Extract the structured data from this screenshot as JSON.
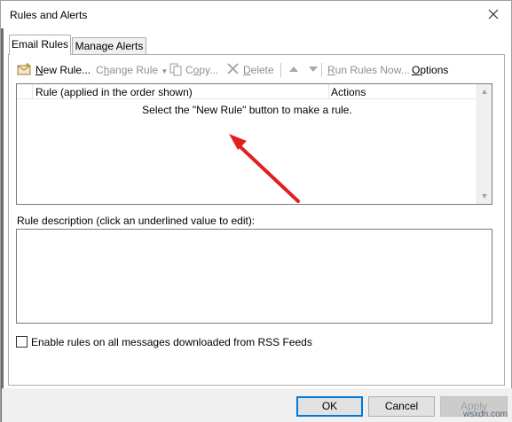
{
  "window": {
    "title": "Rules and Alerts"
  },
  "tabs": [
    {
      "label": "Email Rules",
      "active": true
    },
    {
      "label": "Manage Alerts",
      "active": false
    }
  ],
  "toolbar": {
    "new_rule": {
      "hot": "N",
      "rest": "ew Rule...",
      "icon": "new-rule-icon"
    },
    "change_rule": {
      "hot": "h",
      "pre": "C",
      "rest": "ange Rule",
      "icon": "dropdown-arrow-icon"
    },
    "copy": {
      "hot": "o",
      "pre": "C",
      "rest": "py...",
      "icon": "copy-icon"
    },
    "delete": {
      "hot": "D",
      "rest": "elete",
      "icon": "delete-x-icon"
    },
    "move_up_icon": "arrow-up-icon",
    "move_down_icon": "arrow-down-icon",
    "run_rules": {
      "hot": "R",
      "rest": "un Rules Now..."
    },
    "options": {
      "hot": "O",
      "rest": "ptions"
    }
  },
  "rules_list": {
    "columns": [
      "Rule (applied in the order shown)",
      "Actions"
    ],
    "empty_message": "Select the \"New Rule\" button to make a rule."
  },
  "description": {
    "label": "Rule description (click an underlined value to edit):",
    "value": ""
  },
  "rss_checkbox": {
    "label": "Enable rules on all messages downloaded from RSS Feeds",
    "checked": false
  },
  "buttons": {
    "ok": "OK",
    "cancel": "Cancel",
    "apply": "Apply"
  },
  "watermark": "wsxdn.com",
  "colors": {
    "arrow": "#e02020",
    "accent": "#0078d7",
    "disabled_text": "#8f8f8f"
  }
}
